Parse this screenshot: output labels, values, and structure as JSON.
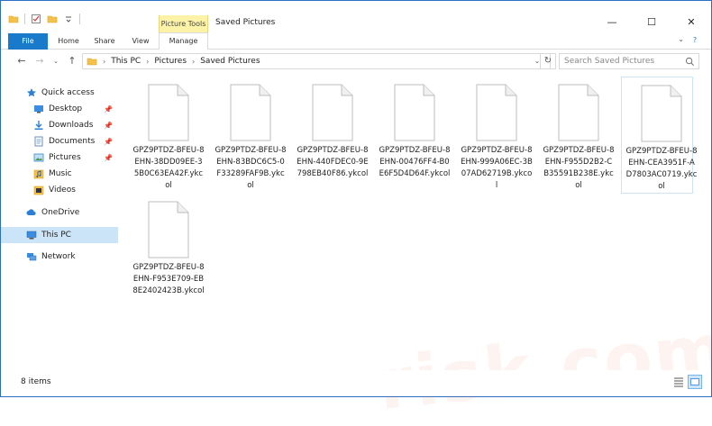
{
  "window": {
    "title": "Saved Pictures",
    "context_tab": "Picture Tools"
  },
  "controls": {
    "minimize": "—",
    "maximize": "☐",
    "close": "✕"
  },
  "ribbon": {
    "tabs": [
      {
        "label": "File"
      },
      {
        "label": "Home"
      },
      {
        "label": "Share"
      },
      {
        "label": "View"
      },
      {
        "label": "Manage"
      }
    ],
    "help": "?",
    "collapse": "⌄"
  },
  "address": {
    "crumbs": [
      "This PC",
      "Pictures",
      "Saved Pictures"
    ],
    "search_placeholder": "Search Saved Pictures"
  },
  "sidebar": {
    "items": [
      {
        "label": "Quick access"
      },
      {
        "label": "Desktop"
      },
      {
        "label": "Downloads"
      },
      {
        "label": "Documents"
      },
      {
        "label": "Pictures"
      },
      {
        "label": "Music"
      },
      {
        "label": "Videos"
      },
      {
        "label": "OneDrive"
      },
      {
        "label": "This PC"
      },
      {
        "label": "Network"
      }
    ]
  },
  "files": [
    {
      "name": "GPZ9PTDZ-BFEU-8EHN-38DD09EE-35B0C63EA42F.ykcol"
    },
    {
      "name": "GPZ9PTDZ-BFEU-8EHN-83BDC6C5-0F33289FAF9B.ykcol"
    },
    {
      "name": "GPZ9PTDZ-BFEU-8EHN-440FDEC0-9E798EB40F86.ykcol"
    },
    {
      "name": "GPZ9PTDZ-BFEU-8EHN-00476FF4-B0E6F5D4D64F.ykcol"
    },
    {
      "name": "GPZ9PTDZ-BFEU-8EHN-999A06EC-3B07AD62719B.ykcol"
    },
    {
      "name": "GPZ9PTDZ-BFEU-8EHN-F955D2B2-CB35591B238E.ykcol"
    },
    {
      "name": "GPZ9PTDZ-BFEU-8EHN-CEA3951F-AD7803AC0719.ykcol"
    },
    {
      "name": "GPZ9PTDZ-BFEU-8EHN-F953E709-EB8E2402423B.ykcol"
    }
  ],
  "status": {
    "count": "8 items"
  },
  "watermark": {
    "text": "risk.com"
  },
  "colors": {
    "accent": "#1979ca",
    "selection": "#cce4f7",
    "context_tab": "#fdf3a8"
  }
}
